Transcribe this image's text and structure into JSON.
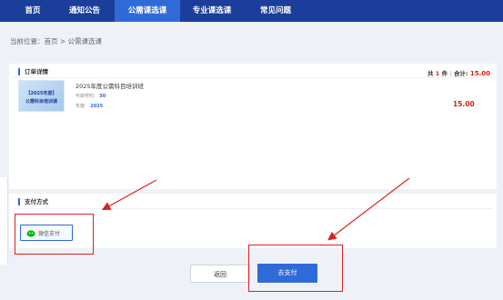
{
  "nav": {
    "items": [
      {
        "label": "首页",
        "active": false
      },
      {
        "label": "通知公告",
        "active": false
      },
      {
        "label": "公需课选课",
        "active": true
      },
      {
        "label": "专业课选课",
        "active": false
      },
      {
        "label": "常见问题",
        "active": false
      }
    ]
  },
  "breadcrumb": {
    "text": "当前位置：首页 > 公需课选课"
  },
  "order": {
    "title": "订单详情",
    "total_prefix": "共",
    "count": "1",
    "total_suffix": "件",
    "total_label": "合计:",
    "total_amount": "15.00",
    "item": {
      "thumb_line1": "【2025年度】",
      "thumb_line2": "公需科目培训课",
      "name": "2025年度公需科目培训班",
      "hours_label": "可获学时:",
      "hours": "30",
      "year_label": "年度:",
      "year": "2025",
      "price": "15.00"
    }
  },
  "payment": {
    "title": "支付方式",
    "method_label": "微信支付",
    "icon": "wechat-pay-icon"
  },
  "actions": {
    "back_label": "返回",
    "pay_label": "去支付"
  },
  "colors": {
    "nav": "#1a3e9a",
    "nav_active": "#2f6bd8",
    "price": "#d81e06",
    "pay_button": "#2f6bd8",
    "annotation": "#e02020"
  }
}
